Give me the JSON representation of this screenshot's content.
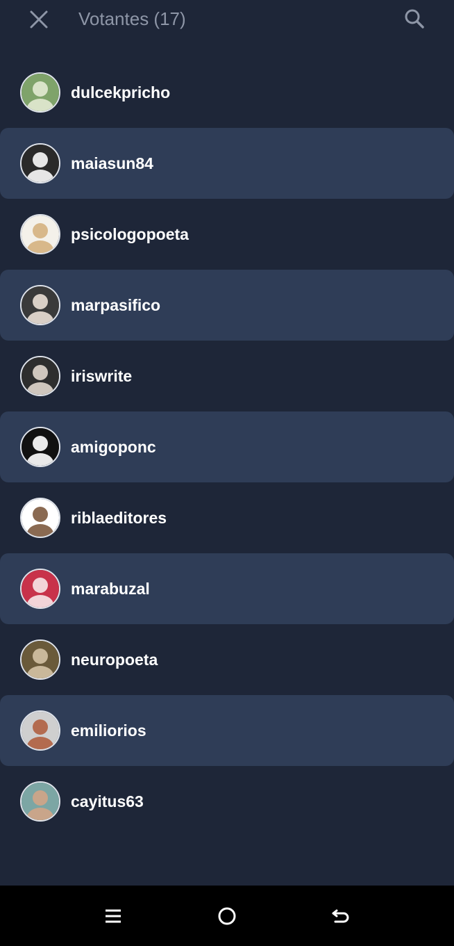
{
  "header": {
    "title": "Votantes (17)",
    "close_icon": "close-icon",
    "search_icon": "search-icon"
  },
  "voters": [
    {
      "username": "dulcekpricho",
      "avatar_colors": [
        "#7fa36a",
        "#d9e3c8"
      ]
    },
    {
      "username": "maiasun84",
      "avatar_colors": [
        "#2a2a2a",
        "#e6e6e6"
      ]
    },
    {
      "username": "psicologopoeta",
      "avatar_colors": [
        "#f4f1ea",
        "#d8b88a"
      ]
    },
    {
      "username": "marpasifico",
      "avatar_colors": [
        "#3a3a3a",
        "#d9cfc6"
      ]
    },
    {
      "username": "iriswrite",
      "avatar_colors": [
        "#2e2e2e",
        "#cfc6bd"
      ]
    },
    {
      "username": "amigoponc",
      "avatar_colors": [
        "#111111",
        "#e9e9e9"
      ]
    },
    {
      "username": "riblaeditores",
      "avatar_colors": [
        "#ffffff",
        "#8a6a52"
      ]
    },
    {
      "username": "marabuzal",
      "avatar_colors": [
        "#c8324a",
        "#f2d4d8"
      ]
    },
    {
      "username": "neuropoeta",
      "avatar_colors": [
        "#6a5a3a",
        "#c9b89a"
      ]
    },
    {
      "username": "emiliorios",
      "avatar_colors": [
        "#cfcfcf",
        "#b36b4f"
      ]
    },
    {
      "username": "cayitus63",
      "avatar_colors": [
        "#7ca6a4",
        "#c9a58a"
      ]
    }
  ],
  "navbar": {
    "recents_icon": "recents-icon",
    "home_icon": "home-icon",
    "back_icon": "back-icon"
  },
  "colors": {
    "background": "#1e2638",
    "row_highlight": "#2f3d57",
    "title_text": "#8e96a7",
    "username_text": "#ffffff"
  }
}
